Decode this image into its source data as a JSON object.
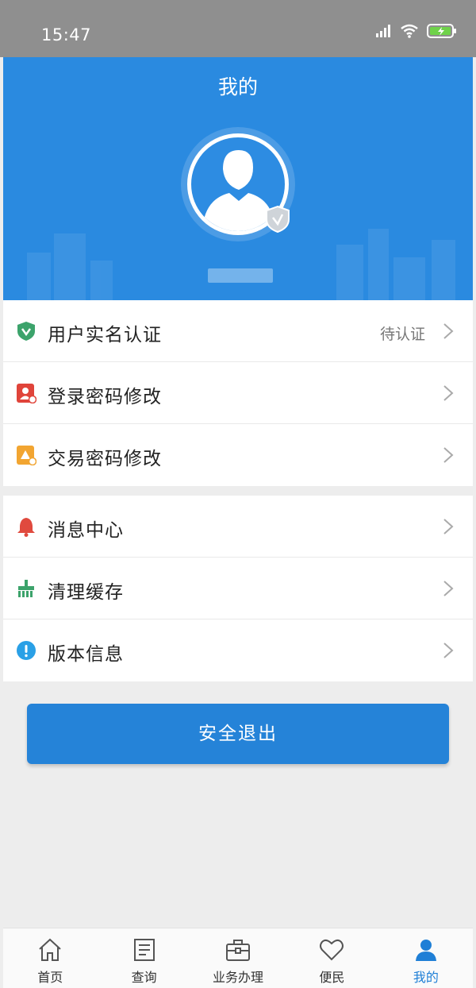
{
  "status_bar": {
    "time": "15:47"
  },
  "header": {
    "title": "我的"
  },
  "menu_group_1": [
    {
      "label": "用户实名认证",
      "value": "待认证",
      "icon": "verified-shield-icon"
    },
    {
      "label": "登录密码修改",
      "icon": "login-password-icon"
    },
    {
      "label": "交易密码修改",
      "icon": "transaction-password-icon"
    }
  ],
  "menu_group_2": [
    {
      "label": "消息中心",
      "icon": "bell-icon"
    },
    {
      "label": "清理缓存",
      "icon": "broom-icon"
    },
    {
      "label": "版本信息",
      "icon": "info-icon"
    }
  ],
  "logout_label": "安全退出",
  "tabbar": [
    {
      "label": "首页",
      "icon": "home-icon",
      "active": false
    },
    {
      "label": "查询",
      "icon": "document-icon",
      "active": false
    },
    {
      "label": "业务办理",
      "icon": "briefcase-icon",
      "active": false
    },
    {
      "label": "便民",
      "icon": "heart-icon",
      "active": false
    },
    {
      "label": "我的",
      "icon": "user-icon",
      "active": true
    }
  ],
  "colors": {
    "primary": "#2a8ae0",
    "button": "#2583d8",
    "active_tab": "#1f7fd6",
    "shield_green": "#3ca36b",
    "bell_red": "#e04a3e",
    "info_blue": "#2aa0e6"
  }
}
